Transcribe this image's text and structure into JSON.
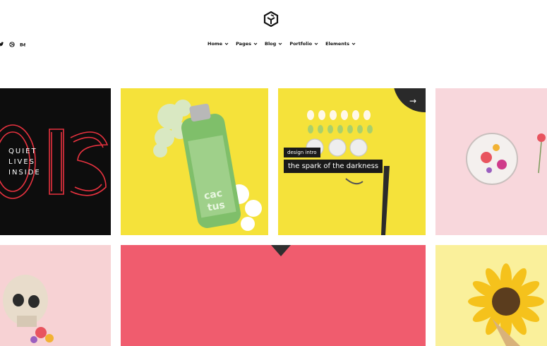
{
  "header": {
    "logo_icon": "cube-logo-icon",
    "social_icons": [
      "twitter-icon",
      "dribbble-icon",
      "behance-icon"
    ],
    "nav": [
      {
        "label": "Home"
      },
      {
        "label": "Pages"
      },
      {
        "label": "Blog"
      },
      {
        "label": "Portfolio"
      },
      {
        "label": "Elements"
      }
    ]
  },
  "portfolio": {
    "tile1_text": [
      "QUIET",
      "LIVES",
      "INSIDE"
    ],
    "featured": {
      "category": "design intro",
      "title": "the spark of the darkness"
    }
  },
  "colors": {
    "yellow": "#f5e23a",
    "pink": "#f8d7dc",
    "coral": "#f05c6e",
    "dark": "#1a1a1a"
  }
}
